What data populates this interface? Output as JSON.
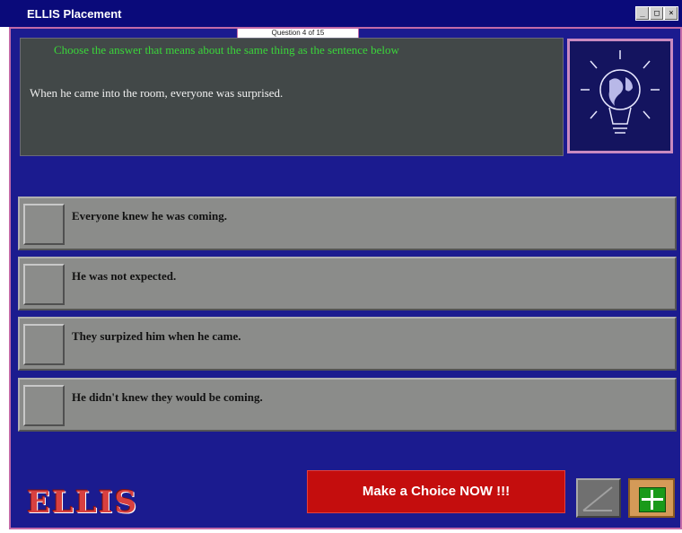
{
  "window": {
    "title": "ELLIS Placement",
    "buttons": [
      "_",
      "□",
      "×"
    ]
  },
  "question": {
    "counter": "Question 4 of 15",
    "instruction": "Choose the answer that means about the same thing as the sentence below",
    "sentence": "When he came into the room, everyone was surprised."
  },
  "answers": [
    {
      "label": "Everyone knew he was coming."
    },
    {
      "label": "He was not expected."
    },
    {
      "label": "They surpized him when he came."
    },
    {
      "label": "He didn't knew they would be coming."
    }
  ],
  "footer": {
    "logo": "ELLIS",
    "choice_prompt": "Make a Choice NOW !!!"
  },
  "icons": {
    "illustration": "globe-lightbulb-icon",
    "next": "next-arrow-icon",
    "exit": "exit-icon"
  },
  "colors": {
    "titlebar": "#0a0a7a",
    "background": "#1b1b8f",
    "panel": "#424848",
    "instruction": "#3ad63a",
    "answer": "#8b8c8a",
    "choice_button": "#c40d0d",
    "border_accent": "#c26aa8"
  }
}
